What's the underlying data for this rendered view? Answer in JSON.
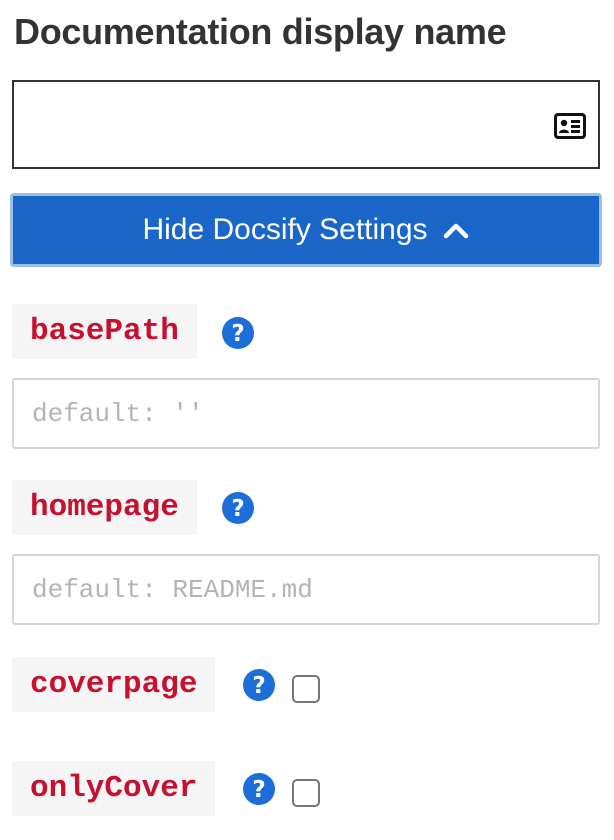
{
  "form": {
    "title": "Documentation display name",
    "display_name_value": ""
  },
  "toggle": {
    "label": "Hide Docsify Settings"
  },
  "settings": [
    {
      "key": "basePath",
      "type": "text",
      "placeholder": "default: ''",
      "value": ""
    },
    {
      "key": "homepage",
      "type": "text",
      "placeholder": "default: README.md",
      "value": ""
    },
    {
      "key": "coverpage",
      "type": "checkbox",
      "checked": false
    },
    {
      "key": "onlyCover",
      "type": "checkbox",
      "checked": false
    }
  ],
  "icons": {
    "name_field": "contact-card-icon",
    "toggle": "chevron-up-icon",
    "help": "question-circle-icon"
  },
  "colors": {
    "primary": "#1a66c9",
    "help_icon": "#1d6ed8",
    "setting_key": "#c7102f",
    "title": "#333333"
  }
}
